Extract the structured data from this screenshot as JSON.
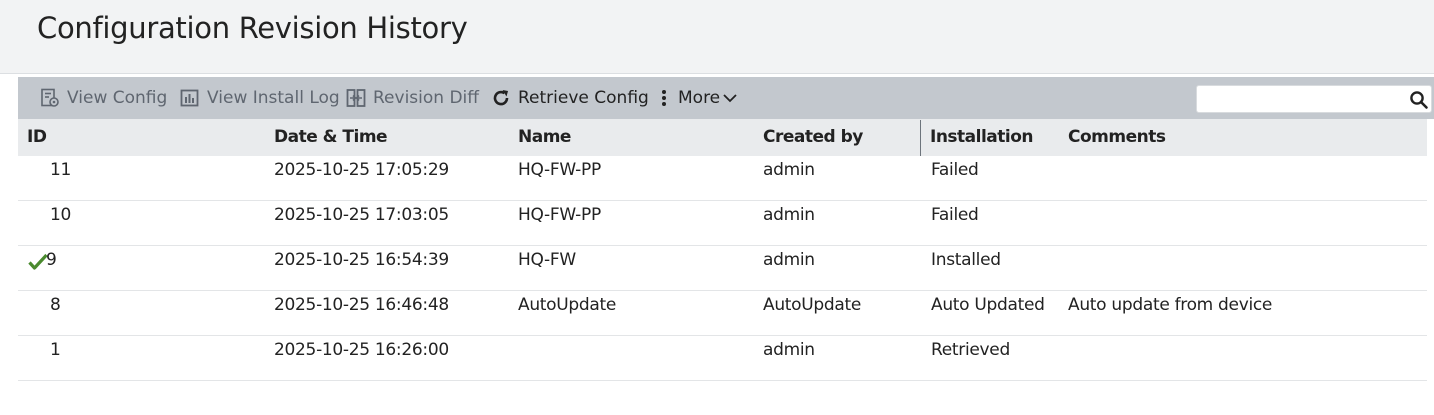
{
  "page": {
    "title": "Configuration Revision History"
  },
  "toolbar": {
    "view_config": "View Config",
    "view_install_log": "View Install Log",
    "revision_diff": "Revision Diff",
    "retrieve_config": "Retrieve Config",
    "more": "More",
    "search_placeholder": "",
    "search_value": ""
  },
  "table": {
    "columns": [
      "ID",
      "Date & Time",
      "Name",
      "Created by",
      "Installation",
      "Comments"
    ],
    "rows": [
      {
        "id": "11",
        "datetime": "2025-10-25 17:05:29",
        "name": "HQ-FW-PP",
        "created_by": "admin",
        "installation": "Failed",
        "comments": "",
        "current": false
      },
      {
        "id": "10",
        "datetime": "2025-10-25 17:03:05",
        "name": "HQ-FW-PP",
        "created_by": "admin",
        "installation": "Failed",
        "comments": "",
        "current": false
      },
      {
        "id": "9",
        "datetime": "2025-10-25 16:54:39",
        "name": "HQ-FW",
        "created_by": "admin",
        "installation": "Installed",
        "comments": "",
        "current": true
      },
      {
        "id": "8",
        "datetime": "2025-10-25 16:46:48",
        "name": "AutoUpdate",
        "created_by": "AutoUpdate",
        "installation": "Auto Updated",
        "comments": "Auto update from device",
        "current": false
      },
      {
        "id": "1",
        "datetime": "2025-10-25 16:26:00",
        "name": "",
        "created_by": "admin",
        "installation": "Retrieved",
        "comments": "",
        "current": false
      }
    ]
  },
  "icons": {
    "view_config": "view-config-icon",
    "view_install_log": "install-log-icon",
    "revision_diff": "revision-diff-icon",
    "retrieve_config": "refresh-icon",
    "more": "kebab-icon",
    "search": "search-icon",
    "installed_marker": "checkmark-icon"
  },
  "colors": {
    "toolbar_bg": "#c3c8ce",
    "header_bg": "#e9ebed",
    "page_header_bg": "#f2f3f4",
    "check_green": "#4a8a2e",
    "disabled_text": "#5f6670"
  }
}
